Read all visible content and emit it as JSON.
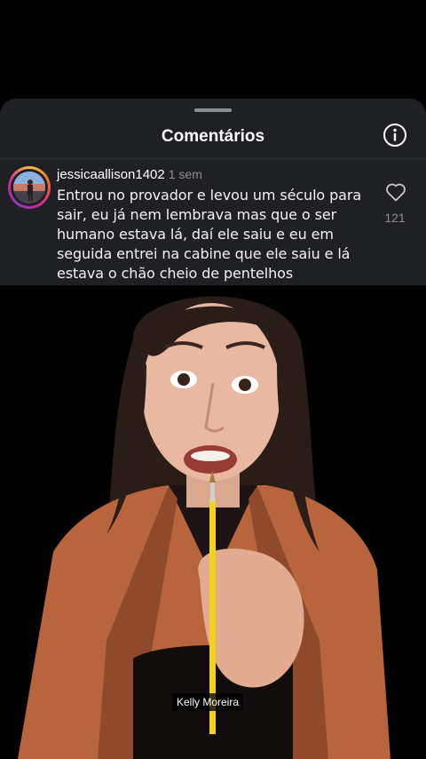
{
  "sheet": {
    "title": "Comentários",
    "info_icon": "info-circle-icon"
  },
  "comment": {
    "username": "jessicaallison1402",
    "timestamp": "1 sem",
    "text": "Entrou no provador e levou um século para\nsair, eu já nem  lembrava mas que o ser\nhumano estava lá, daí ele saiu e eu em\nseguida entrei na cabine  que ele saiu e lá\nestava o chão cheio de pentelhos",
    "like_icon": "heart-outline-icon",
    "likes": "121"
  },
  "video": {
    "name_label": "Kelly Moreira"
  },
  "colors": {
    "sheet_background": "#1f2023",
    "story_ring": "#d6248f",
    "text_secondary": "#8e8e93"
  }
}
